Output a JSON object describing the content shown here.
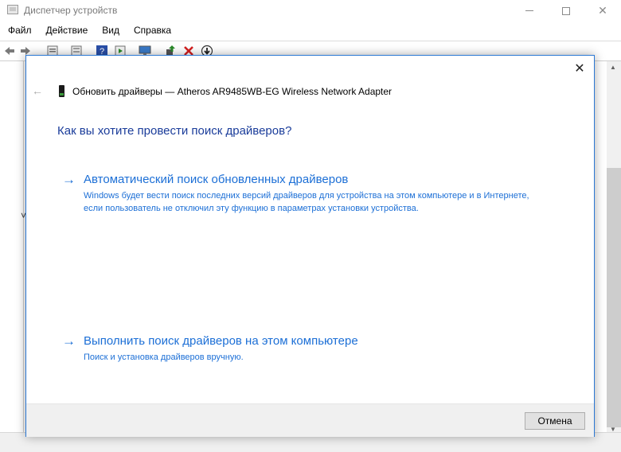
{
  "window": {
    "title": "Диспетчер устройств",
    "controls": {
      "minimize": "minimize-icon",
      "maximize": "maximize-icon",
      "close": "close-icon"
    }
  },
  "menu": [
    "Файл",
    "Действие",
    "Вид",
    "Справка"
  ],
  "toolbar_icons": [
    "back-arrow-icon",
    "forward-arrow-icon",
    "properties-icon",
    "list-view-icon",
    "help-icon",
    "device-view-icon",
    "monitor-icon",
    "update-driver-icon",
    "uninstall-icon",
    "download-icon"
  ],
  "dialog": {
    "header_title": "Обновить драйверы — Atheros AR9485WB-EG Wireless Network Adapter",
    "question": "Как вы хотите провести поиск драйверов?",
    "options": [
      {
        "title": "Автоматический поиск обновленных драйверов",
        "description": "Windows будет вести поиск последних версий драйверов для устройства на этом компьютере и в Интернете, если пользователь не отключил эту функцию в параметрах установки устройства."
      },
      {
        "title": "Выполнить поиск драйверов на этом компьютере",
        "description": "Поиск и установка драйверов вручную."
      }
    ],
    "cancel_label": "Отмена"
  },
  "colors": {
    "link_blue": "#1c6fd6",
    "heading_blue": "#1a3c9a",
    "dialog_border": "#2b78d4",
    "delete_red": "#d42020",
    "update_green": "#2a8a2a"
  }
}
